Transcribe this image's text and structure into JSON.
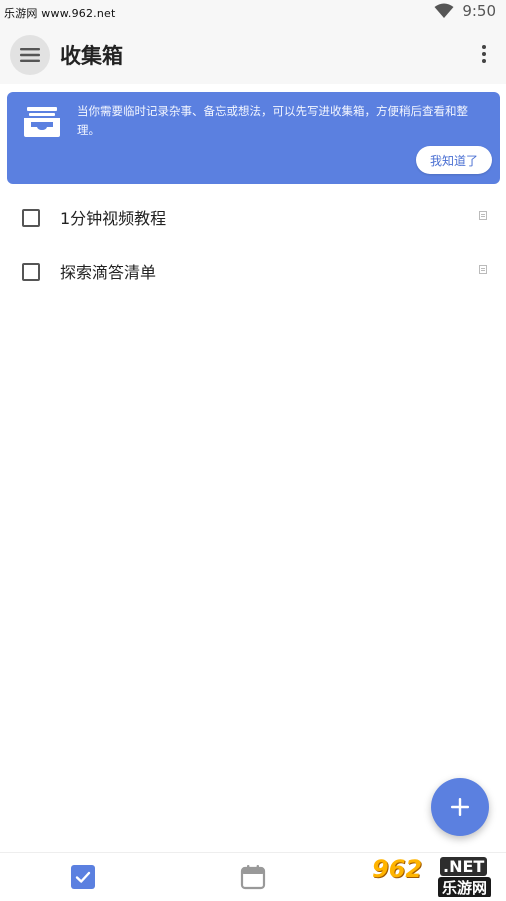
{
  "status_bar": {
    "watermark": "乐游网 www.962.net",
    "time": "9:50",
    "wifi_icon": "wifi-icon"
  },
  "app_bar": {
    "title": "收集箱",
    "menu_icon": "hamburger-menu-icon",
    "more_icon": "more-vertical-icon"
  },
  "tip_card": {
    "icon": "inbox-tray-icon",
    "text": "当你需要临时记录杂事、备忘或想法，可以先写进收集箱，方便稍后查看和整理。",
    "button_label": "我知道了",
    "background_color": "#5b80e0"
  },
  "tasks": [
    {
      "label": "1分钟视频教程",
      "checked": false,
      "note_icon": "note-icon"
    },
    {
      "label": "探索滴答清单",
      "checked": false,
      "note_icon": "note-icon"
    }
  ],
  "fab": {
    "icon": "plus-icon",
    "color": "#5b80e0"
  },
  "bottom_nav": {
    "items": [
      {
        "icon": "checkbox-tasks-icon",
        "active": true
      },
      {
        "icon": "calendar-icon",
        "active": false
      }
    ]
  },
  "watermark_logo": {
    "number": "962",
    "suffix": ".NET",
    "name": "乐游网"
  }
}
